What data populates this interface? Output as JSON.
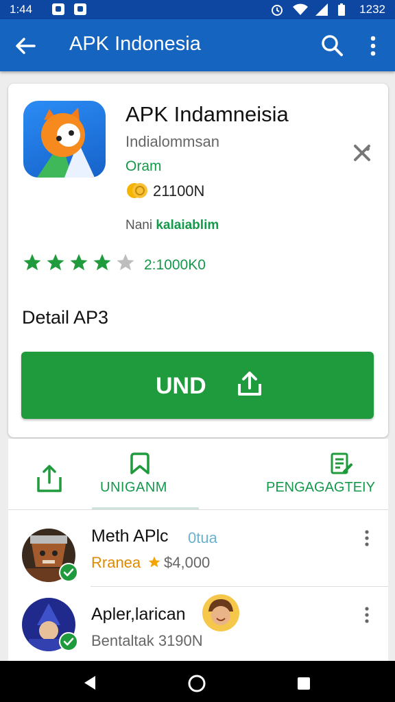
{
  "status_bar": {
    "time_left": "1:44",
    "time_right": "1232"
  },
  "app_bar": {
    "title": "APK Indonesia",
    "icons": [
      "back-arrow-icon",
      "search-icon",
      "more-vert-icon"
    ]
  },
  "app": {
    "name": "APK Indamneisia",
    "developer": "Indialommsan",
    "category": "Oram",
    "downloads": "21100N",
    "availability_prefix": "Nani",
    "availability_value": "kalaiablim",
    "rating": 4,
    "rating_max": 5,
    "reviews": "2:1000K0",
    "section_title": "Detail AP3",
    "install_label": "UND"
  },
  "tabs": [
    {
      "label": "",
      "icon": "share-upload-icon"
    },
    {
      "label": "UNIGANM",
      "icon": "bookmark-icon",
      "selected": true
    },
    {
      "label": "PENGAGAGTEIY",
      "icon": "document-edit-icon"
    }
  ],
  "list": [
    {
      "name": "Meth APlc",
      "tag": "0tua",
      "sub_prefix": "Rranea",
      "sub_value": "$4,000",
      "avatar": "cartoon-fox-avatar",
      "verified": true
    },
    {
      "name": "Apler,larican",
      "sub": "Bentaltak 3190N",
      "avatar": "wizard-avatar",
      "verified": true
    }
  ],
  "colors": {
    "status_bar": "#0d47a1",
    "app_bar": "#1565c0",
    "accent_green": "#1f9b3d",
    "star_empty": "#bdbdbd"
  },
  "nav_bar": {
    "icons": [
      "nav-back-icon",
      "nav-home-icon",
      "nav-recents-icon"
    ]
  }
}
